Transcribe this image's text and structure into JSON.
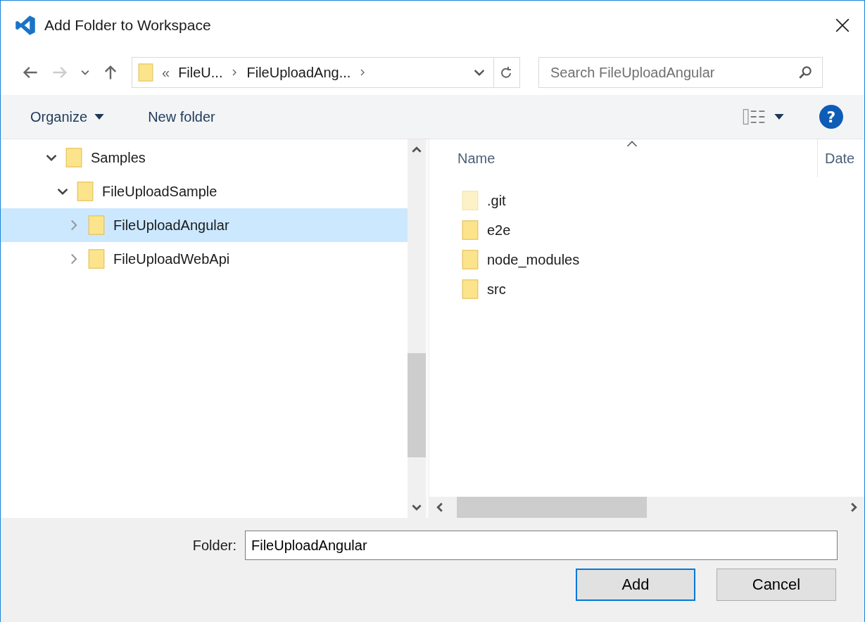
{
  "window": {
    "title": "Add Folder to Workspace"
  },
  "nav": {
    "overflow": "«",
    "breadcrumbs": [
      "FileU...",
      "FileUploadAng..."
    ]
  },
  "search": {
    "placeholder": "Search FileUploadAngular"
  },
  "toolbar": {
    "organize": "Organize",
    "new_folder": "New folder",
    "help": "?"
  },
  "tree": [
    {
      "label": "Samples",
      "expanded": true,
      "selected": false,
      "children": [
        {
          "label": "FileUploadSample",
          "expanded": true,
          "selected": false,
          "children": [
            {
              "label": "FileUploadAngular",
              "expanded": false,
              "selected": true
            },
            {
              "label": "FileUploadWebApi",
              "expanded": false,
              "selected": false
            }
          ]
        }
      ]
    }
  ],
  "columns": [
    "Name",
    "Date"
  ],
  "files": [
    {
      "name": ".git",
      "hidden": true
    },
    {
      "name": "e2e",
      "hidden": false
    },
    {
      "name": "node_modules",
      "hidden": false
    },
    {
      "name": "src",
      "hidden": false
    }
  ],
  "folder_field": {
    "label": "Folder:",
    "value": "FileUploadAngular"
  },
  "buttons": [
    {
      "label": "Add",
      "default": true
    },
    {
      "label": "Cancel",
      "default": false
    }
  ]
}
